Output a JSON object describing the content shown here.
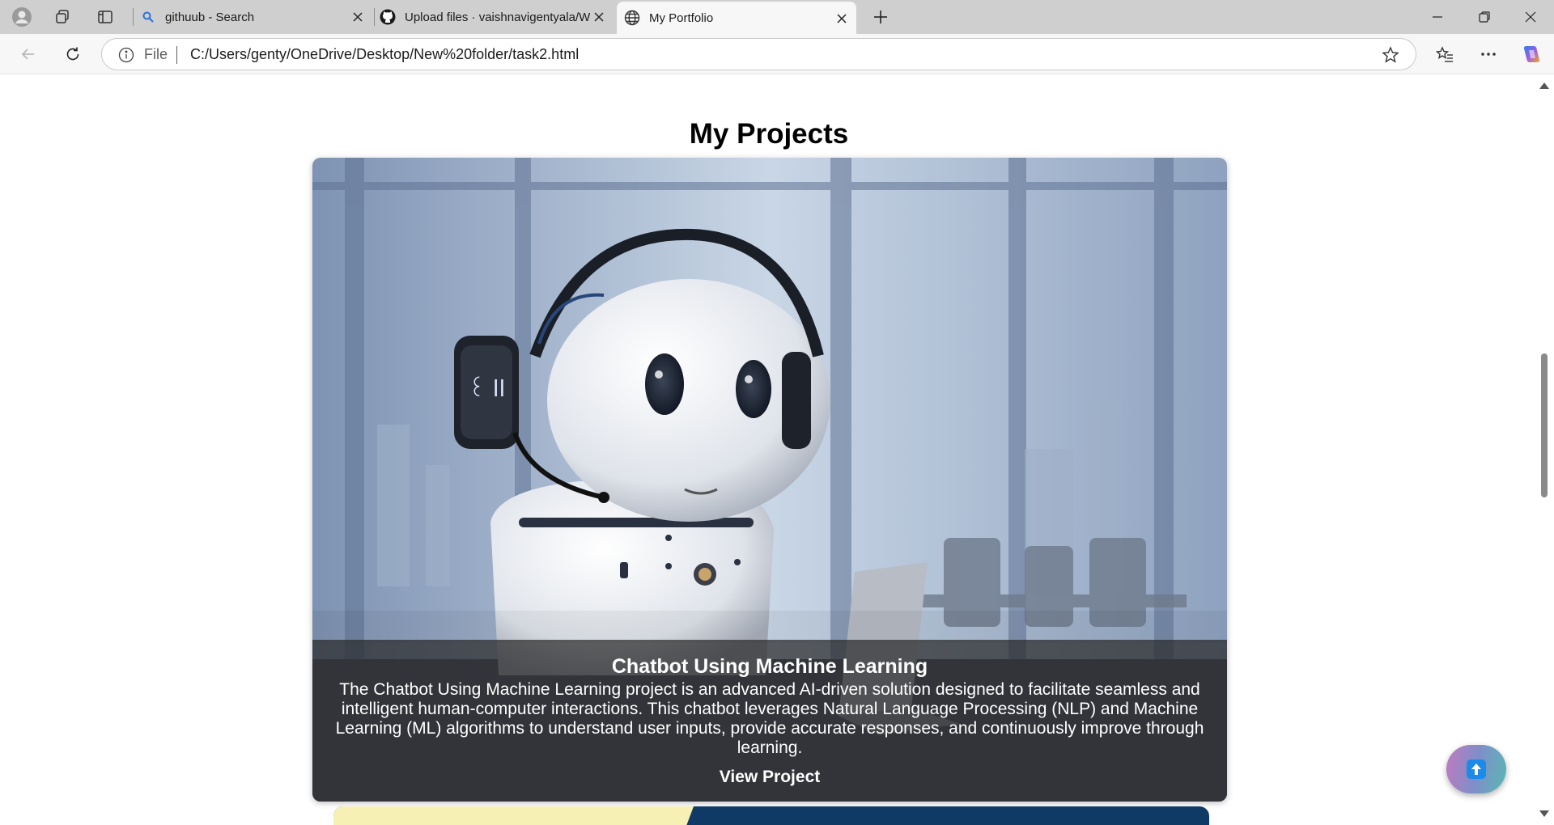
{
  "browser": {
    "tabs": [
      {
        "label": "githuub - Search",
        "icon": "search-icon"
      },
      {
        "label": "Upload files · vaishnavigentyala/W",
        "icon": "github-icon"
      },
      {
        "label": "My Portfolio",
        "icon": "globe-icon",
        "active": true
      }
    ],
    "address": {
      "scheme_label": "File",
      "url": "C:/Users/genty/OneDrive/Desktop/New%20folder/task2.html"
    }
  },
  "page": {
    "heading": "My Projects",
    "project": {
      "title": "Chatbot Using Machine Learning",
      "description": "The Chatbot Using Machine Learning project is an advanced AI-driven solution designed to facilitate seamless and intelligent human-computer interactions. This chatbot leverages Natural Language Processing (NLP) and Machine Learning (ML) algorithms to understand user inputs, provide accurate responses, and continuously improve through learning.",
      "link_label": "View Project"
    }
  },
  "colors": {
    "tabstrip": "#cfcfcf",
    "caption_overlay": "rgba(40,40,40,0.72)",
    "fab_icon": "#1c8be8"
  }
}
